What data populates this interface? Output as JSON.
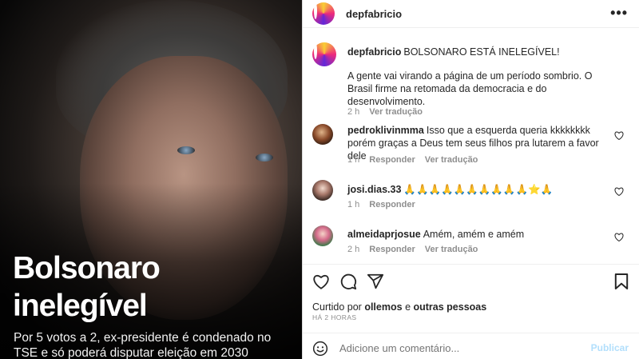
{
  "media": {
    "headline": "Bolsonaro inelegível",
    "subheadline": "Por 5 votos a 2, ex-presidente é condenado no TSE e só poderá disputar eleição em 2030"
  },
  "header": {
    "username": "depfabricio",
    "more_icon": "more-horizontal-icon"
  },
  "caption": {
    "username": "depfabricio",
    "headline": "BOLSONARO ESTÁ INELEGÍVEL!",
    "text": "A gente vai virando a página de um período sombrio. O Brasil firme na retomada da democracia e do desenvolvimento.",
    "time": "2 h",
    "see_translation": "Ver tradução"
  },
  "comments": [
    {
      "username": "pedroklivinmma",
      "text": "Isso que a esquerda queria kkkkkkkk porém graças a Deus tem seus filhos pra lutarem a favor dele",
      "time": "1 h",
      "reply": "Responder",
      "see_translation": "Ver tradução"
    },
    {
      "username": "josi.dias.33",
      "text": "🙏🙏🙏🙏🙏🙏🙏🙏🙏🙏⭐🙏",
      "time": "1 h",
      "reply": "Responder"
    },
    {
      "username": "almeidaprjosue",
      "text": "Amém, amém e amém",
      "time": "2 h",
      "reply": "Responder",
      "see_translation": "Ver tradução"
    }
  ],
  "likes": {
    "prefix": "Curtido por",
    "user": "ollemos",
    "conjunction": "e",
    "others": "outras pessoas"
  },
  "timestamp": "HÁ 2 HORAS",
  "add_comment": {
    "placeholder": "Adicione um comentário...",
    "post_label": "Publicar"
  },
  "colors": {
    "accent_disabled": "#b2dffc",
    "text_primary": "#262626",
    "text_secondary": "#8e8e8e"
  }
}
